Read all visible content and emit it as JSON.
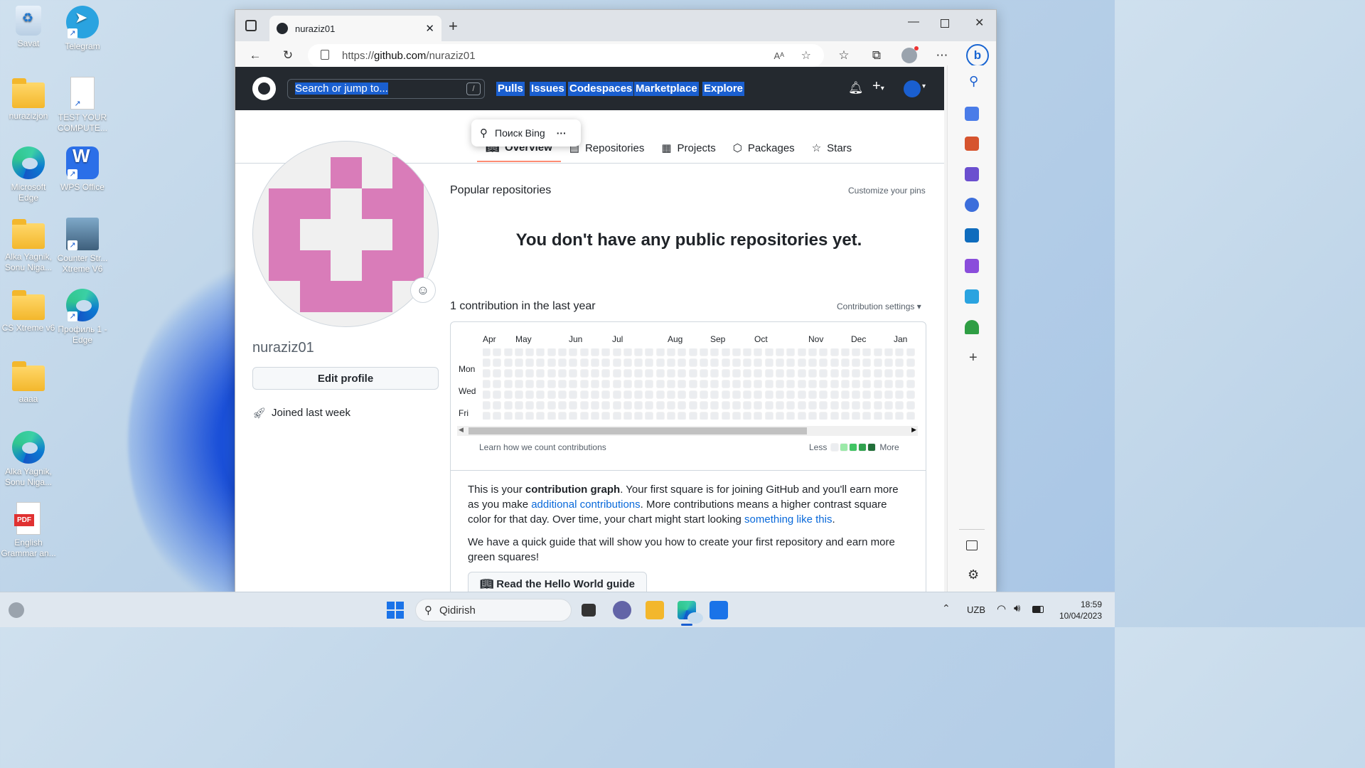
{
  "desktop": {
    "icons": [
      {
        "label": "Savat"
      },
      {
        "label": "Telegram"
      },
      {
        "label": "nurazizjon"
      },
      {
        "label": "TEST YOUR COMPUTE..."
      },
      {
        "label": "Microsoft Edge"
      },
      {
        "label": "WPS Office"
      },
      {
        "label": "Alka Yagnik, Sonu Niga..."
      },
      {
        "label": "Counter Str... Xtreme V6"
      },
      {
        "label": "CS Xtreme v6"
      },
      {
        "label": "Профиль 1 - Edge"
      },
      {
        "label": "aaaa"
      },
      {
        "label": "Alka Yagnik, Sonu Niga..."
      },
      {
        "label": "English Grammar an..."
      }
    ],
    "pdf_badge": "PDF"
  },
  "browser": {
    "tab_title": "nuraziz01",
    "url_prefix": "https://",
    "url_host": "github.com",
    "url_path": "/nuraziz01",
    "read_aloud": "Aᴬ"
  },
  "github": {
    "search_placeholder": "Search or jump to...",
    "search_hint": "/",
    "nav": [
      "Pulls",
      "Issues",
      "Codespaces",
      "Marketplace",
      "Explore"
    ],
    "profile_tabs": [
      "Overview",
      "Repositories",
      "Projects",
      "Packages",
      "Stars"
    ],
    "username": "nuraziz01",
    "edit_profile": "Edit profile",
    "joined": "Joined last week",
    "popular_title": "Popular repositories",
    "customize_pins": "Customize your pins",
    "no_repos": "You don't have any public repositories yet.",
    "contrib_title": "1 contribution in the last year",
    "contrib_settings": "Contribution settings",
    "months": [
      "Apr",
      "May",
      "Jun",
      "Jul",
      "Aug",
      "Sep",
      "Oct",
      "Nov",
      "Dec",
      "Jan"
    ],
    "weekdays": [
      "Mon",
      "Wed",
      "Fri"
    ],
    "learn_link": "Learn how we count contributions",
    "less": "Less",
    "more": "More",
    "legend_colors": [
      "#ebedf0",
      "#9be9a8",
      "#40c463",
      "#30a14e",
      "#216e39"
    ],
    "graph_intro_1": "This is your ",
    "graph_intro_bold": "contribution graph",
    "graph_intro_2": ". Your first square is for joining GitHub and you'll earn more as you make ",
    "graph_link_1": "additional contributions",
    "graph_intro_3": ". More contributions means a higher contrast square color for that day. Over time, your chart might start looking ",
    "graph_link_2": "something like this",
    "graph_intro_4": ".",
    "guide_text": "We have a quick guide that will show you how to create your first repository and earn more green squares!",
    "guide_button": "Read the Hello World guide"
  },
  "bing_popup": {
    "label": "Поиск Bing",
    "more": "···"
  },
  "taskbar": {
    "search_placeholder": "Qidirish",
    "lang": "UZB",
    "time": "18:59",
    "date": "10/04/2023"
  }
}
